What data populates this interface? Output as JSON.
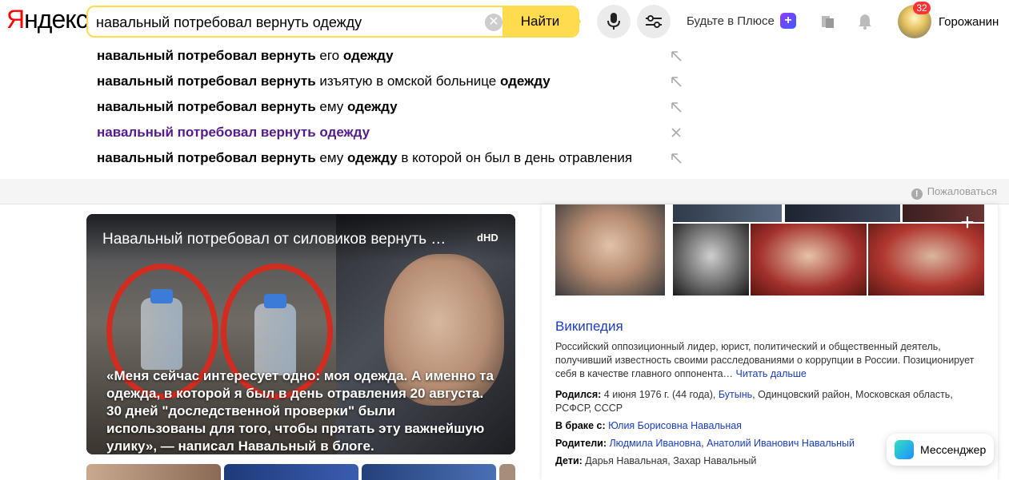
{
  "header": {
    "logo_first_letter": "Я",
    "logo_rest": "ндекс",
    "search_value": "навальный потребовал вернуть одежду",
    "clear_symbol": "✕",
    "find_label": "Найти",
    "plus_label": "Будьте в Плюсе",
    "plus_badge": "+",
    "notifications_count": "32",
    "username": "Горожанин"
  },
  "suggest": {
    "items": [
      {
        "bold1": "навальный потребовал вернуть",
        "rest1": " его ",
        "bold2": "одежду",
        "rest2": ""
      },
      {
        "bold1": "навальный потребовал вернуть",
        "rest1": " изъятую в омской больнице ",
        "bold2": "одежду",
        "rest2": ""
      },
      {
        "bold1": "навальный потребовал вернуть",
        "rest1": " ему ",
        "bold2": "одежду",
        "rest2": ""
      },
      {
        "visited_text": "навальный потребовал вернуть одежду"
      },
      {
        "bold1": "навальный потребовал вернуть",
        "rest1": " ему ",
        "bold2": "одежду",
        "rest2": " в которой он был в день отравления"
      }
    ],
    "complain_label": "Пожаловаться",
    "complain_icon": "!"
  },
  "video": {
    "title": "Навальный потребовал от силовиков вернуть …",
    "hd": "dHD",
    "quote": "«Меня сейчас интересует одно: моя одежда. А именно та одежда, в которой я был в день отравления 20 августа. 30 дней \"доследственной проверки\" были использованы для того, чтобы прятать эту важнейшую улику», — написал Навальный в блоге."
  },
  "knowledge_panel": {
    "more_photos_symbol": "+",
    "wiki_title": "Википедия",
    "wiki_text": "Российский оппозиционный лидер, юрист, политический и общественный деятель, получивший известность своими расследованиями о коррупции в России. Позиционирует себя в качестве главного оппонента…",
    "wiki_more": "Читать дальше",
    "born_label": "Родился:",
    "born_text": " 4 июня 1976 г. (44 года), ",
    "born_link": "Бутынь",
    "born_rest": ", Одинцовский район, Московская область, РСФСР, СССР",
    "married_label": "В браке с:",
    "married_link": "Юлия Борисовна Навальная",
    "parents_label": "Родители:",
    "parent1": "Людмила Ивановна",
    "parents_sep": ", ",
    "parent2": "Анатолий Иванович Навальный",
    "children_label": "Дети:",
    "children_text": " Дарья Навальная, Захар Навальный"
  },
  "messenger": {
    "label": "Мессенджер"
  },
  "colors": {
    "accent_yellow": "#ffdb4d",
    "link_blue": "#1a3dc1",
    "visited_purple": "#551a8b",
    "logo_red": "#ff0000"
  }
}
